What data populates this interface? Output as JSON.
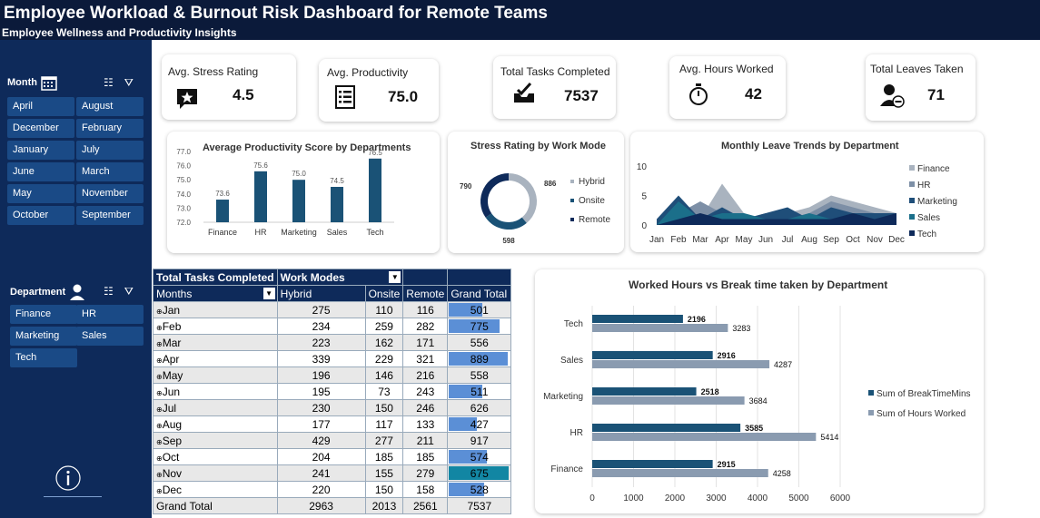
{
  "header": {
    "title": "Employee Workload & Burnout Risk Dashboard for Remote Teams",
    "subtitle": "Employee Wellness and Productivity Insights"
  },
  "slicers": {
    "month": {
      "label": "Month",
      "items": [
        "April",
        "August",
        "December",
        "February",
        "January",
        "July",
        "June",
        "March",
        "May",
        "November",
        "October",
        "September"
      ]
    },
    "department": {
      "label": "Department",
      "items": [
        "Finance",
        "HR",
        "Marketing",
        "Sales",
        "Tech"
      ]
    }
  },
  "kpis": [
    {
      "label": "Avg. Stress Rating",
      "value": "4.5",
      "icon": "stress-star-icon"
    },
    {
      "label": "Avg. Productivity",
      "value": "75.0",
      "icon": "clipboard-list-icon"
    },
    {
      "label": "Total Tasks Completed",
      "value": "7537",
      "icon": "tasks-check-icon"
    },
    {
      "label": "Avg. Hours Worked",
      "value": "42",
      "icon": "stopwatch-icon"
    },
    {
      "label": "Total Leaves Taken",
      "value": "71",
      "icon": "person-minus-icon"
    }
  ],
  "colors": {
    "navy": "#0e2a5a",
    "bar_dark": "#1a5276",
    "bar_grey": "#8a9bb0",
    "teal": "#1b6f8a",
    "highlight": "#1286a3"
  },
  "chart_data": [
    {
      "type": "bar",
      "title": "Average Productivity Score by Departments",
      "categories": [
        "Finance",
        "HR",
        "Marketing",
        "Sales",
        "Tech"
      ],
      "values": [
        73.6,
        75.6,
        75.0,
        74.5,
        76.5
      ],
      "ylim": [
        72.0,
        77.0
      ],
      "yticks": [
        "77.0",
        "76.0",
        "75.0",
        "74.0",
        "73.0",
        "72.0"
      ],
      "data_labels": [
        "73.6",
        "75.6",
        "75.0",
        "74.5",
        "76.5"
      ]
    },
    {
      "type": "pie",
      "title": "Stress Rating by Work Mode",
      "categories": [
        "Hybrid",
        "Onsite",
        "Remote"
      ],
      "values": [
        886,
        598,
        790
      ],
      "legend": "right"
    },
    {
      "type": "area",
      "title": "Monthly Leave Trends by Department",
      "x": [
        "Jan",
        "Feb",
        "Mar",
        "Apr",
        "May",
        "Jun",
        "Jul",
        "Aug",
        "Sep",
        "Oct",
        "Nov",
        "Dec"
      ],
      "yticks": [
        "10",
        "5",
        "0"
      ],
      "ylim": [
        0,
        10
      ],
      "series": [
        {
          "name": "Finance",
          "values": [
            1,
            3,
            1,
            7,
            2,
            1,
            2,
            3,
            5,
            4,
            3,
            2
          ]
        },
        {
          "name": "HR",
          "values": [
            0,
            2,
            4,
            2,
            1,
            2,
            1,
            2,
            4,
            3,
            2,
            2
          ]
        },
        {
          "name": "Marketing",
          "values": [
            1,
            5,
            1,
            3,
            1,
            2,
            3,
            1,
            3,
            2,
            2,
            2
          ]
        },
        {
          "name": "Sales",
          "values": [
            0,
            4,
            1,
            2,
            2,
            1,
            1,
            2,
            1,
            2,
            1,
            1
          ]
        },
        {
          "name": "Tech",
          "values": [
            0,
            1,
            2,
            1,
            1,
            1,
            1,
            1,
            1,
            2,
            1,
            2
          ]
        }
      ],
      "legend": "right"
    },
    {
      "type": "bar",
      "orientation": "horizontal",
      "title": "Worked Hours vs Break time taken by Department",
      "categories": [
        "Tech",
        "Sales",
        "Marketing",
        "HR",
        "Finance"
      ],
      "series": [
        {
          "name": "Sum of BreakTimeMins",
          "values": [
            2196,
            2916,
            2518,
            3585,
            2915
          ]
        },
        {
          "name": "Sum of Hours Worked",
          "values": [
            3283,
            4287,
            3684,
            5414,
            4258
          ]
        }
      ],
      "xlim": [
        0,
        6000
      ],
      "xticks": [
        "0",
        "1000",
        "2000",
        "3000",
        "4000",
        "5000",
        "6000"
      ],
      "legend": "right"
    },
    {
      "type": "table",
      "title": "Total Tasks Completed",
      "headers": {
        "corner": "Total Tasks Completed",
        "columns_field": "Work Modes",
        "rows_field": "Months",
        "cols": [
          "Hybrid",
          "Onsite",
          "Remote",
          "Grand Total"
        ]
      },
      "rows": [
        {
          "month": "Jan",
          "hybrid": "275",
          "onsite": "110",
          "remote": "116",
          "total": "501",
          "bar": 0.55
        },
        {
          "month": "Feb",
          "hybrid": "234",
          "onsite": "259",
          "remote": "282",
          "total": "775",
          "bar": 0.85
        },
        {
          "month": "Mar",
          "hybrid": "223",
          "onsite": "162",
          "remote": "171",
          "total": "556",
          "bar": 0
        },
        {
          "month": "Apr",
          "hybrid": "339",
          "onsite": "229",
          "remote": "321",
          "total": "889",
          "bar": 0.98
        },
        {
          "month": "May",
          "hybrid": "196",
          "onsite": "146",
          "remote": "216",
          "total": "558",
          "bar": 0
        },
        {
          "month": "Jun",
          "hybrid": "195",
          "onsite": "73",
          "remote": "243",
          "total": "511",
          "bar": 0.56
        },
        {
          "month": "Jul",
          "hybrid": "230",
          "onsite": "150",
          "remote": "246",
          "total": "626",
          "bar": 0
        },
        {
          "month": "Aug",
          "hybrid": "177",
          "onsite": "117",
          "remote": "133",
          "total": "427",
          "bar": 0.47
        },
        {
          "month": "Sep",
          "hybrid": "429",
          "onsite": "277",
          "remote": "211",
          "total": "917",
          "bar": 0
        },
        {
          "month": "Oct",
          "hybrid": "204",
          "onsite": "185",
          "remote": "185",
          "total": "574",
          "bar": 0.63
        },
        {
          "month": "Nov",
          "hybrid": "241",
          "onsite": "155",
          "remote": "279",
          "total": "675",
          "bar": 1
        },
        {
          "month": "Dec",
          "hybrid": "220",
          "onsite": "150",
          "remote": "158",
          "total": "528",
          "bar": 0.58
        }
      ],
      "grand_total": {
        "label": "Grand Total",
        "hybrid": "2963",
        "onsite": "2013",
        "remote": "2561",
        "total": "7537"
      }
    }
  ]
}
